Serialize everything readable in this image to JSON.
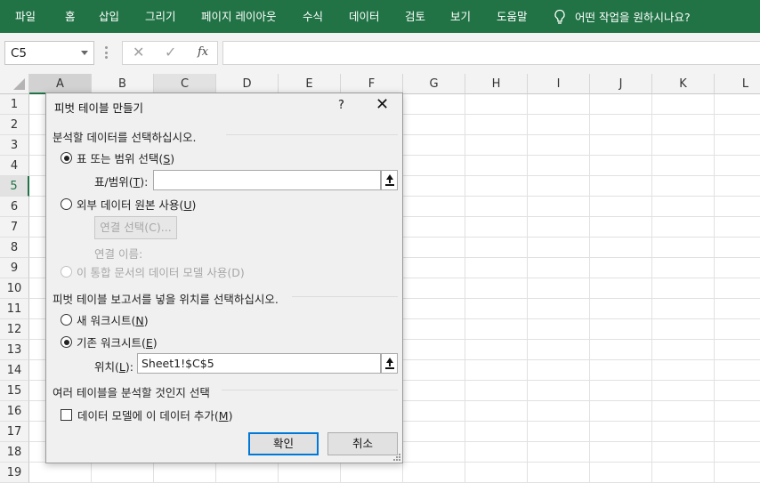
{
  "ribbon": {
    "tabs": [
      "파일",
      "홈",
      "삽입",
      "그리기",
      "페이지 레이아웃",
      "수식",
      "데이터",
      "검토",
      "보기",
      "도움말"
    ],
    "tell_me": "어떤 작업을 원하시나요?",
    "accent": "#217346"
  },
  "formula_bar": {
    "name_box": "C5",
    "fx": "fx",
    "formula": ""
  },
  "sheet": {
    "columns": [
      "A",
      "B",
      "C",
      "D",
      "E",
      "F",
      "G",
      "H",
      "I",
      "J",
      "K",
      "L"
    ],
    "rows": [
      "1",
      "2",
      "3",
      "4",
      "5",
      "6",
      "7",
      "8",
      "9",
      "10",
      "11",
      "12",
      "13",
      "14",
      "15",
      "16",
      "17",
      "18",
      "19"
    ],
    "selected_column": "A",
    "active_column": "C",
    "active_row": "5"
  },
  "dialog": {
    "title": "피벗 테이블 만들기",
    "help": "?",
    "close": "✕",
    "section_source": "분석할 데이터를 선택하십시오.",
    "opt_table_range": "표 또는 범위 선택(",
    "opt_table_range_key": "S",
    "range_label": "표/범위(",
    "range_label_key": "T",
    "range_value": "",
    "opt_external": "외부 데이터 원본 사용(",
    "opt_external_key": "U",
    "choose_connection": "연결 선택(C)...",
    "connection_name": "연결 이름:",
    "opt_data_model": "이 통합 문서의 데이터 모델 사용(D)",
    "section_location": "피벗 테이블 보고서를 넣을 위치를 선택하십시오.",
    "opt_new_sheet": "새 워크시트(",
    "opt_new_sheet_key": "N",
    "opt_existing_sheet": "기존 워크시트(",
    "opt_existing_sheet_key": "E",
    "location_label": "위치(",
    "location_label_key": "L",
    "location_value": "Sheet1!$C$5",
    "section_multi": "여러 테이블을 분석할 것인지 선택",
    "add_to_model": "데이터 모델에 이 데이터 추가(",
    "add_to_model_key": "M",
    "ok": "확인",
    "cancel": "취소",
    "focus_color": "#0078d7"
  }
}
